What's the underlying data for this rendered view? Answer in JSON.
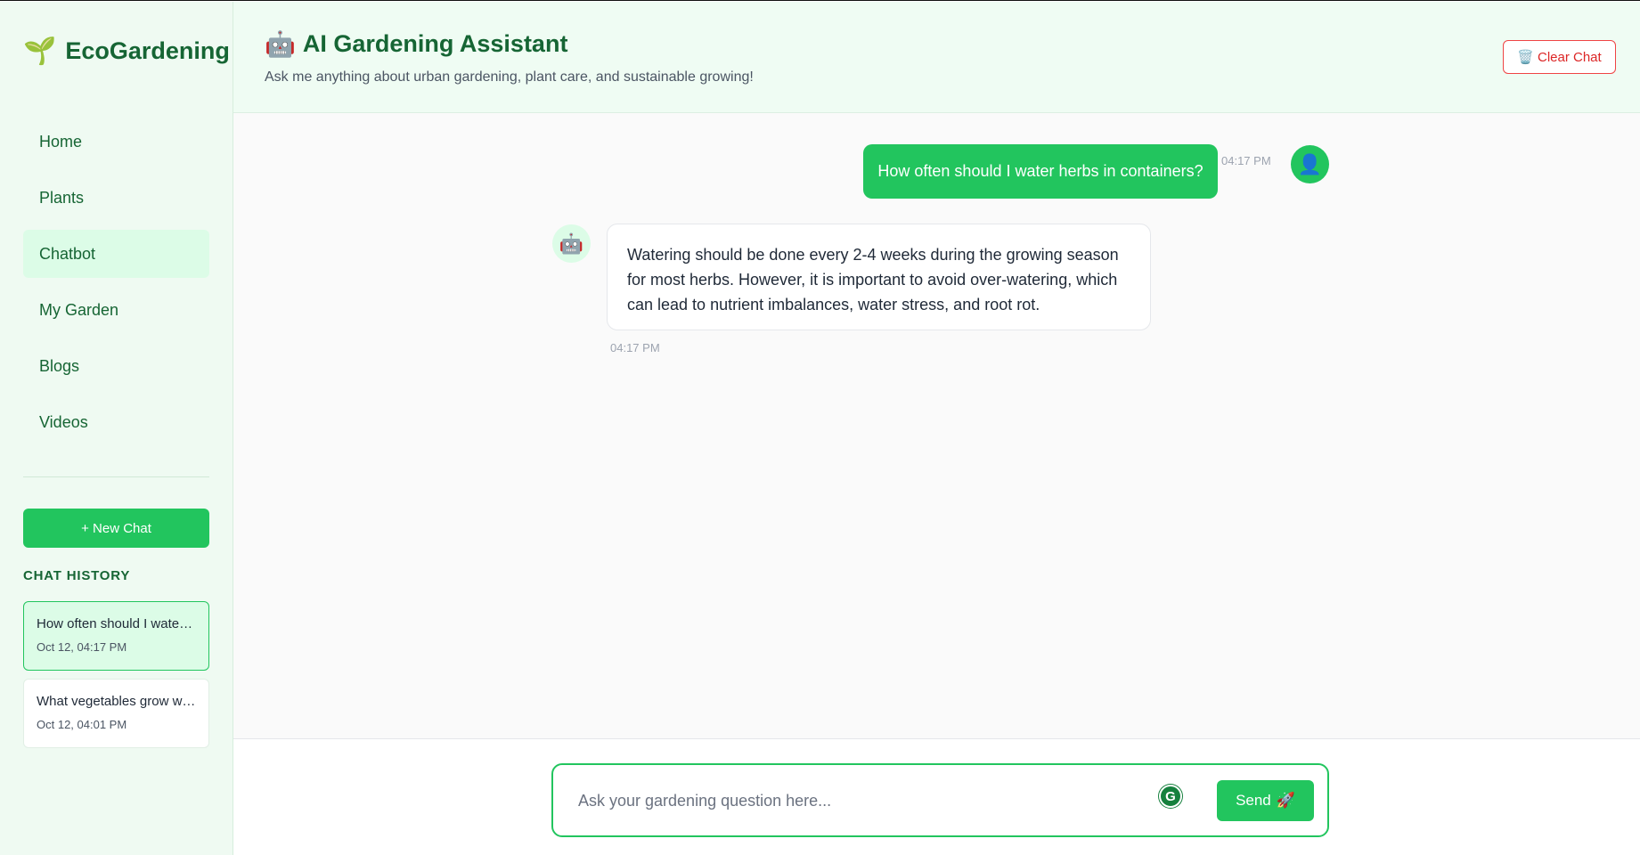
{
  "brand": {
    "icon": "🌱",
    "name": "EcoGardening"
  },
  "nav": {
    "items": [
      {
        "label": "Home"
      },
      {
        "label": "Plants"
      },
      {
        "label": "Chatbot",
        "active": true
      },
      {
        "label": "My Garden"
      },
      {
        "label": "Blogs"
      },
      {
        "label": "Videos"
      }
    ]
  },
  "sidebar": {
    "new_chat_label": "+ New Chat",
    "history_title": "CHAT HISTORY",
    "history": [
      {
        "question": "How often should I water herbs in containers?",
        "date": "Oct 12, 04:17 PM",
        "active": true
      },
      {
        "question": "What vegetables grow well in small spaces?",
        "date": "Oct 12, 04:01 PM"
      }
    ]
  },
  "header": {
    "icon": "🤖",
    "title": "AI Gardening Assistant",
    "subtitle": "Ask me anything about urban gardening, plant care, and sustainable growing!",
    "clear_icon": "🗑️",
    "clear_label": "Clear Chat"
  },
  "messages": [
    {
      "role": "user",
      "text": "How often should I water herbs in containers?",
      "time": "04:17 PM",
      "avatar": "👤"
    },
    {
      "role": "bot",
      "text": "Watering should be done every 2-4 weeks during the growing season for most herbs. However, it is important to avoid over-watering, which can lead to nutrient imbalances, water stress, and root rot.",
      "time": "04:17 PM",
      "avatar": "🤖"
    }
  ],
  "composer": {
    "placeholder": "Ask your gardening question here...",
    "value": "",
    "grammarly_glyph": "G",
    "send_label": "Send",
    "send_icon": "🚀"
  },
  "colors": {
    "accent": "#22c55e",
    "brand_text": "#166534",
    "danger": "#ef4444",
    "sidebar_bg": "#effaf2"
  }
}
